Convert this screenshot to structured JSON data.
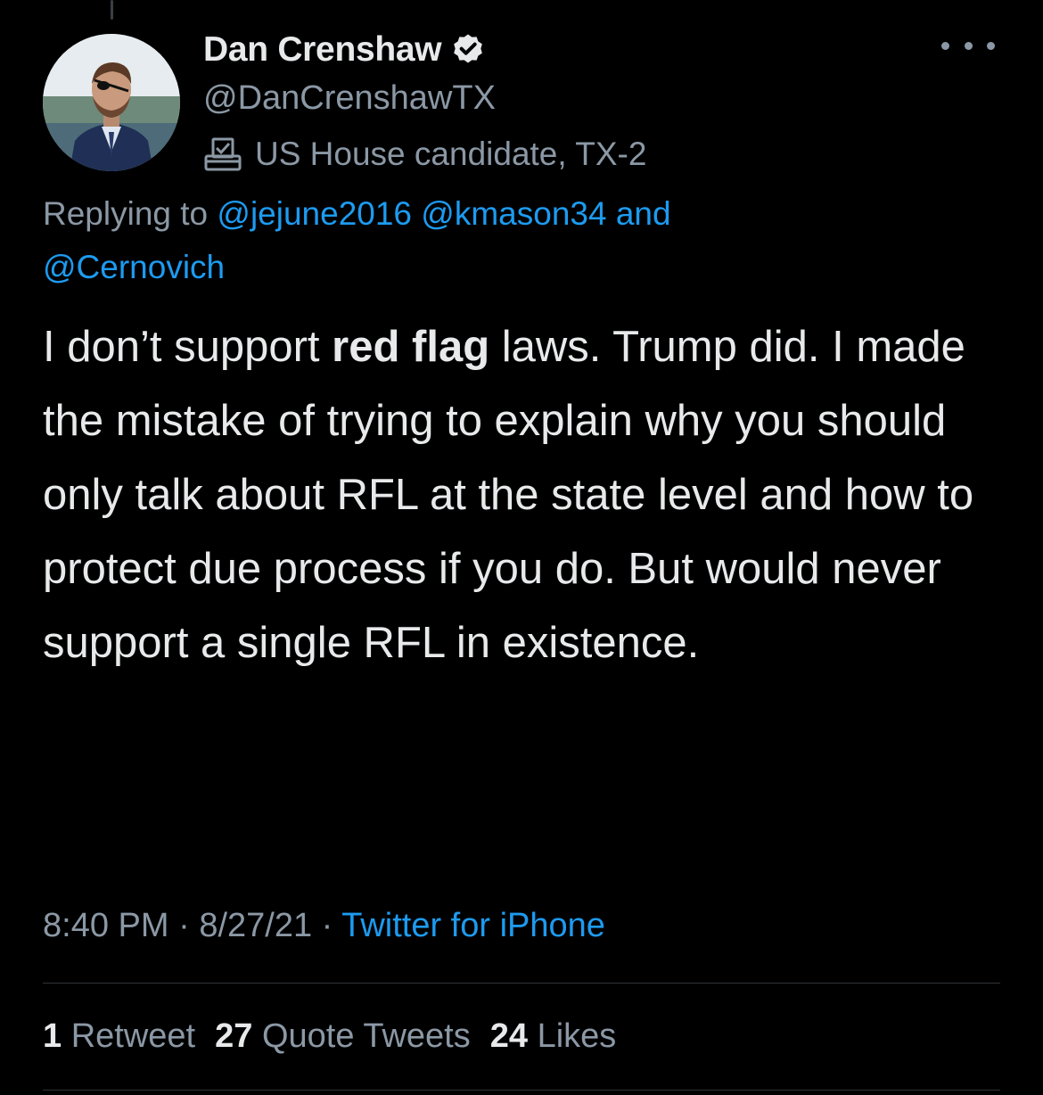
{
  "author": {
    "display_name": "Dan Crenshaw",
    "handle": "@DanCrenshawTX",
    "label": "US House candidate, TX-2",
    "verified_icon": "verified-badge-icon",
    "label_icon": "ballot-box-icon"
  },
  "reply": {
    "prefix": "Replying to",
    "mention_1": "@jejune2016",
    "mention_2": "@kmason34",
    "conjunction": "and",
    "mention_3": "@Cernovich"
  },
  "tweet": {
    "text_before": "I don’t support ",
    "text_bold": "red flag",
    "text_after": " laws. Trump did. I made the mistake of trying to explain why you should only talk about RFL at the state level and how to protect due process if you do. But would never support a single RFL in existence."
  },
  "meta": {
    "time": "8:40 PM",
    "separator": "·",
    "date": "8/27/21",
    "source": "Twitter for iPhone"
  },
  "stats": {
    "retweets_count": "1",
    "retweets_label": "Retweet",
    "quotes_count": "27",
    "quotes_label": "Quote Tweets",
    "likes_count": "24",
    "likes_label": "Likes"
  },
  "colors": {
    "background": "#000000",
    "text": "#e7e9ea",
    "secondary": "#8b98a5",
    "link": "#1d9bf0"
  }
}
